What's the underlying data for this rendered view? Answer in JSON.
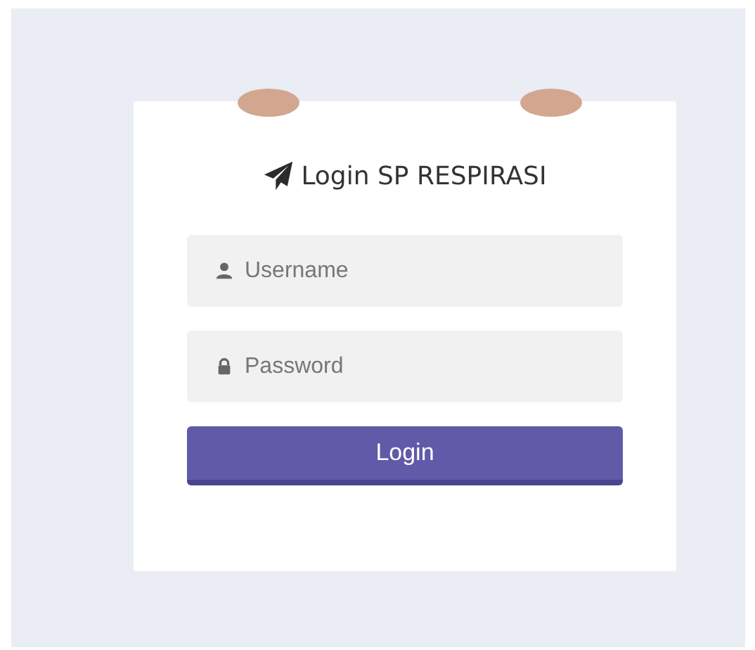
{
  "title": "Login SP RESPIRASI",
  "fields": [
    {
      "kind": "user",
      "placeholder": "Username"
    },
    {
      "kind": "password",
      "placeholder": "Password"
    }
  ],
  "button": "Login"
}
